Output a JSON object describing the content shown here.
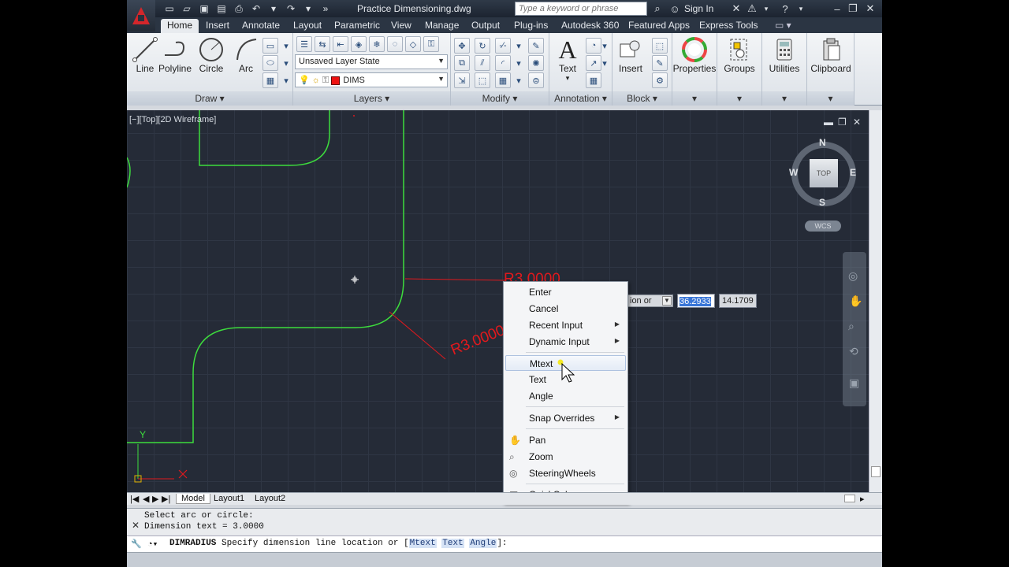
{
  "titlebar": {
    "doc_title": "Practice Dimensioning.dwg",
    "search_placeholder": "Type a keyword or phrase",
    "sign_in": "Sign In"
  },
  "tabs": [
    "Home",
    "Insert",
    "Annotate",
    "Layout",
    "Parametric",
    "View",
    "Manage",
    "Output",
    "Plug-ins",
    "Autodesk 360",
    "Featured Apps",
    "Express Tools"
  ],
  "ribbon": {
    "draw": {
      "title": "Draw",
      "line": "Line",
      "polyline": "Polyline",
      "circle": "Circle",
      "arc": "Arc"
    },
    "layers": {
      "title": "Layers",
      "layer_state": "Unsaved Layer State",
      "current_layer": "DIMS"
    },
    "modify": {
      "title": "Modify"
    },
    "annotation": {
      "title": "Annotation",
      "text": "Text"
    },
    "block": {
      "title": "Block",
      "insert": "Insert"
    },
    "properties": "Properties",
    "groups": "Groups",
    "utilities": "Utilities",
    "clipboard": "Clipboard"
  },
  "viewport": {
    "label": "[−][Top][2D Wireframe]",
    "viewcube": {
      "n": "N",
      "s": "S",
      "e": "E",
      "w": "W",
      "face": "TOP",
      "wcs": "WCS"
    },
    "dimension_labels": [
      "R3.0000",
      "R3.0000"
    ],
    "ucs_y": "Y",
    "colors": {
      "background": "#252b37",
      "geometry": "#3ddc3d",
      "dimension": "#e0191d"
    }
  },
  "dynamic_input": {
    "prompt": "ion or",
    "value1": "36.2933",
    "value2": "14.1709"
  },
  "context_menu": {
    "items": [
      {
        "label": "Enter"
      },
      {
        "label": "Cancel"
      },
      {
        "label": "Recent Input"
      },
      {
        "label": "Dynamic Input"
      },
      {
        "label": "Mtext"
      },
      {
        "label": "Text"
      },
      {
        "label": "Angle"
      },
      {
        "label": "Snap Overrides"
      },
      {
        "label": "Pan"
      },
      {
        "label": "Zoom"
      },
      {
        "label": "SteeringWheels"
      },
      {
        "label": "QuickCalc"
      }
    ]
  },
  "layout_tabs": [
    "Model",
    "Layout1",
    "Layout2"
  ],
  "command": {
    "history": [
      "Select arc or circle:",
      "Dimension text = 3.0000"
    ],
    "current_cmd": "DIMRADIUS",
    "prompt_text": "Specify dimension line location or [",
    "keywords": [
      "Mtext",
      "Text",
      "Angle"
    ],
    "prompt_end": "]:"
  }
}
